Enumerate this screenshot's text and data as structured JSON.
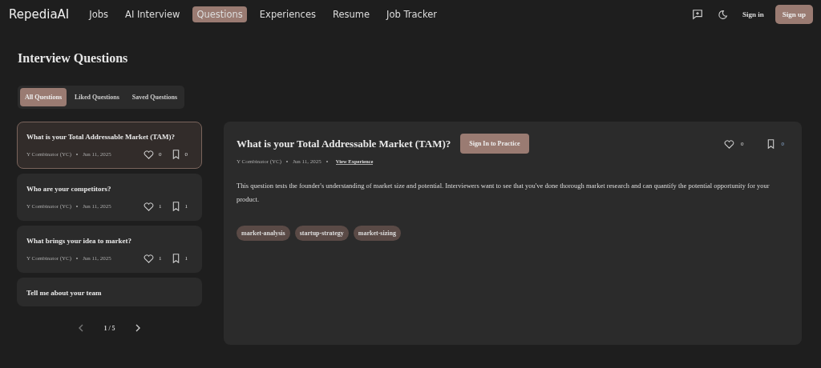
{
  "brand": "RepediaAI",
  "nav": [
    {
      "label": "Jobs",
      "selected": false
    },
    {
      "label": "AI Interview",
      "selected": false
    },
    {
      "label": "Questions",
      "selected": true
    },
    {
      "label": "Experiences",
      "selected": false
    },
    {
      "label": "Resume",
      "selected": false
    },
    {
      "label": "Job Tracker",
      "selected": false
    }
  ],
  "header_actions": {
    "sign_in": "Sign in",
    "sign_up": "Sign up"
  },
  "page_title": "Interview Questions",
  "tabs": [
    {
      "label": "All Questions",
      "selected": true
    },
    {
      "label": "Liked Questions",
      "selected": false
    },
    {
      "label": "Saved Questions",
      "selected": false
    }
  ],
  "questions": [
    {
      "title": "What is your Total Addressable Market (TAM)?",
      "source": "Y Combinator (YC)",
      "date": "Jun 11, 2025",
      "likes": "0",
      "saves": "0",
      "selected": true
    },
    {
      "title": "Who are your competitors?",
      "source": "Y Combinator (YC)",
      "date": "Jun 11, 2025",
      "likes": "1",
      "saves": "1",
      "selected": false
    },
    {
      "title": "What brings your idea to market?",
      "source": "Y Combinator (YC)",
      "date": "Jun 11, 2025",
      "likes": "1",
      "saves": "1",
      "selected": false
    },
    {
      "title": "Tell me about your team",
      "selected": false
    }
  ],
  "pagination": {
    "label": "1 / 5"
  },
  "detail": {
    "title": "What is your Total Addressable Market (TAM)?",
    "practice_button": "Sign In to Practice",
    "likes": "0",
    "saves": "0",
    "source": "Y Combinator (YC)",
    "date": "Jun 11, 2025",
    "link": "View Experience",
    "description": "This question tests the founder's understanding of market size and potential. Interviewers want to see that you've done thorough market research and can quantify the potential opportunity for your product.",
    "tags": [
      "market-analysis",
      "startup-strategy",
      "market-sizing"
    ]
  }
}
